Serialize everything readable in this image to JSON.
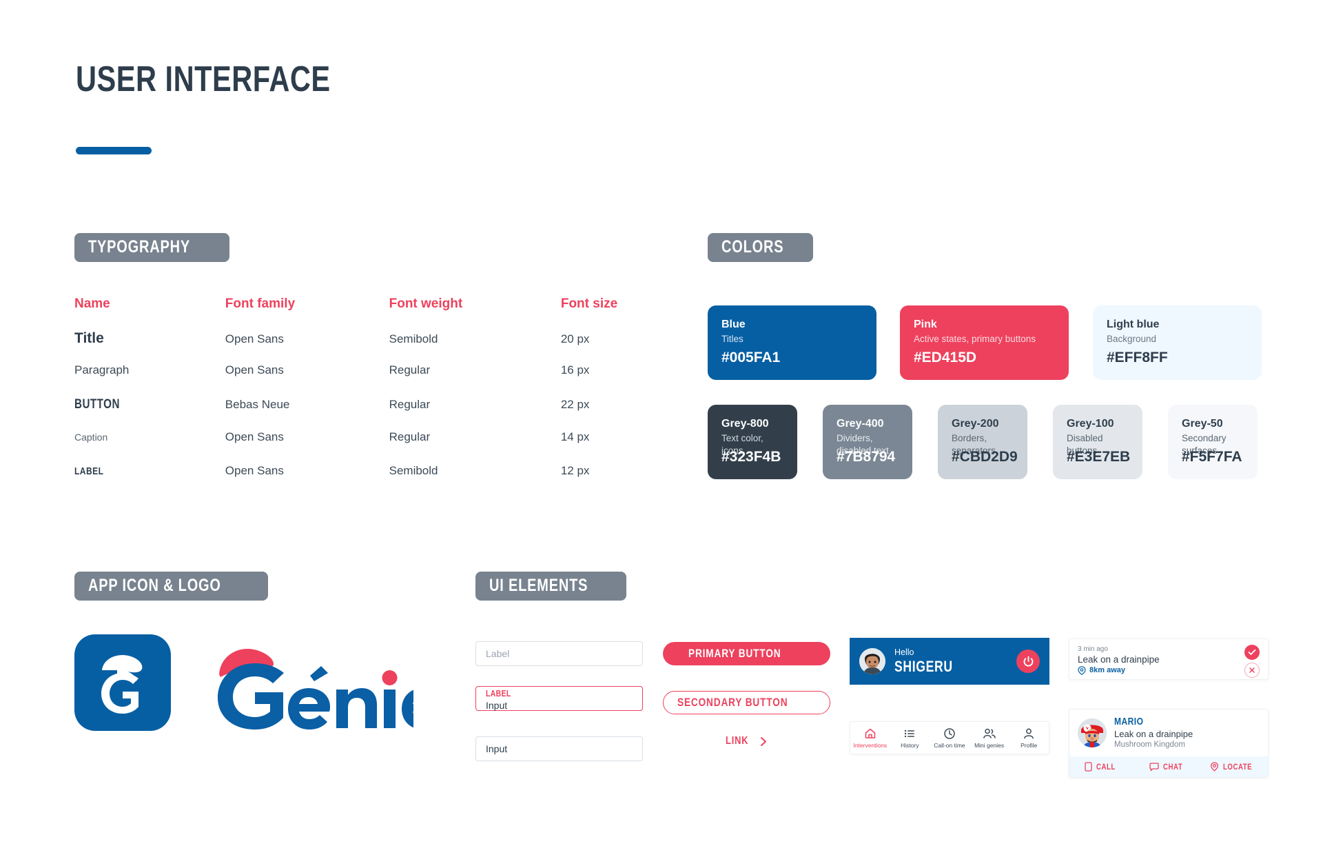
{
  "page": {
    "title": "USER INTERFACE",
    "accent_blue": "#005FA1",
    "accent_pink": "#ED415D",
    "badge_grey": "#78838F"
  },
  "sections": {
    "typography": "TYPOGRAPHY",
    "colors": "COLORS",
    "app_icon_logo": "APP ICON & LOGO",
    "ui_elements": "UI ELEMENTS"
  },
  "typography": {
    "headers": [
      "Name",
      "Font family",
      "Font weight",
      "Font size"
    ],
    "rows": [
      {
        "name": "Title",
        "family": "Open Sans",
        "weight": "Semibold",
        "size": "20 px"
      },
      {
        "name": "Paragraph",
        "family": "Open Sans",
        "weight": "Regular",
        "size": "16 px"
      },
      {
        "name": "BUTTON",
        "family": "Bebas Neue",
        "weight": "Regular",
        "size": "22 px"
      },
      {
        "name": "Caption",
        "family": "Open Sans",
        "weight": "Regular",
        "size": "14 px"
      },
      {
        "name": "LABEL",
        "family": "Open Sans",
        "weight": "Semibold",
        "size": "12 px"
      }
    ]
  },
  "colors": {
    "primary": [
      {
        "name": "Blue",
        "usage": "Titles",
        "hex": "#005FA1",
        "bg": "#075FA3",
        "fg": "#FFFFFF",
        "sub": "#D6E6F3"
      },
      {
        "name": "Pink",
        "usage": "Active states, primary buttons",
        "hex": "#ED415D",
        "bg": "#ED415D",
        "fg": "#FFFFFF",
        "sub": "#FBD9DF"
      },
      {
        "name": "Light blue",
        "usage": "Background",
        "hex": "#EFF8FF",
        "bg": "#EFF8FF",
        "fg": "#2E3D4C",
        "sub": "#6B7884"
      }
    ],
    "greys": [
      {
        "name": "Grey-800",
        "usage": "Text color, icons",
        "hex": "#323F4B",
        "bg": "#323F4B",
        "fg": "#FFFFFF",
        "sub": "#D2D8DE"
      },
      {
        "name": "Grey-400",
        "usage": "Dividers, disabled text",
        "hex": "#7B8794",
        "bg": "#7B8794",
        "fg": "#FFFFFF",
        "sub": "#E7EBEF"
      },
      {
        "name": "Grey-200",
        "usage": "Borders, separators",
        "hex": "#CBD2D9",
        "bg": "#CBD2D9",
        "fg": "#2E3D4C",
        "sub": "#5A6672"
      },
      {
        "name": "Grey-100",
        "usage": "Disabled buttons",
        "hex": "#E3E7EB",
        "bg": "#E3E7EB",
        "fg": "#2E3D4C",
        "sub": "#5A6672"
      },
      {
        "name": "Grey-50",
        "usage": "Secondary surfaces",
        "hex": "#F5F7FA",
        "bg": "#F5F7FA",
        "fg": "#2E3D4C",
        "sub": "#5A6672"
      }
    ]
  },
  "brand": {
    "logo_text": "Génie",
    "app_icon_letter": "G"
  },
  "ui_elements": {
    "inputs": {
      "empty_placeholder": "Label",
      "focused_label": "LABEL",
      "focused_value": "Input",
      "filled_value": "Input"
    },
    "buttons": {
      "primary": "PRIMARY BUTTON",
      "secondary": "SECONDARY BUTTON",
      "link": "LINK"
    },
    "hello_card": {
      "greeting": "Hello",
      "user": "SHIGERU"
    },
    "bottom_nav": [
      {
        "label": "Interventions",
        "icon": "home-icon",
        "active": true
      },
      {
        "label": "History",
        "icon": "list-icon",
        "active": false
      },
      {
        "label": "Call-on time",
        "icon": "clock-icon",
        "active": false
      },
      {
        "label": "Mini genies",
        "icon": "people-icon",
        "active": false
      },
      {
        "label": "Profile",
        "icon": "person-icon",
        "active": false
      }
    ],
    "notification": {
      "time": "3 min ago",
      "title": "Leak on a drainpipe",
      "distance": "8km away"
    },
    "contact": {
      "name": "MARIO",
      "job": "Leak on a drainpipe",
      "place": "Mushroom Kingdom",
      "actions": [
        {
          "label": "CALL",
          "icon": "phone-icon"
        },
        {
          "label": "CHAT",
          "icon": "chat-icon"
        },
        {
          "label": "LOCATE",
          "icon": "pin-icon"
        }
      ]
    }
  }
}
